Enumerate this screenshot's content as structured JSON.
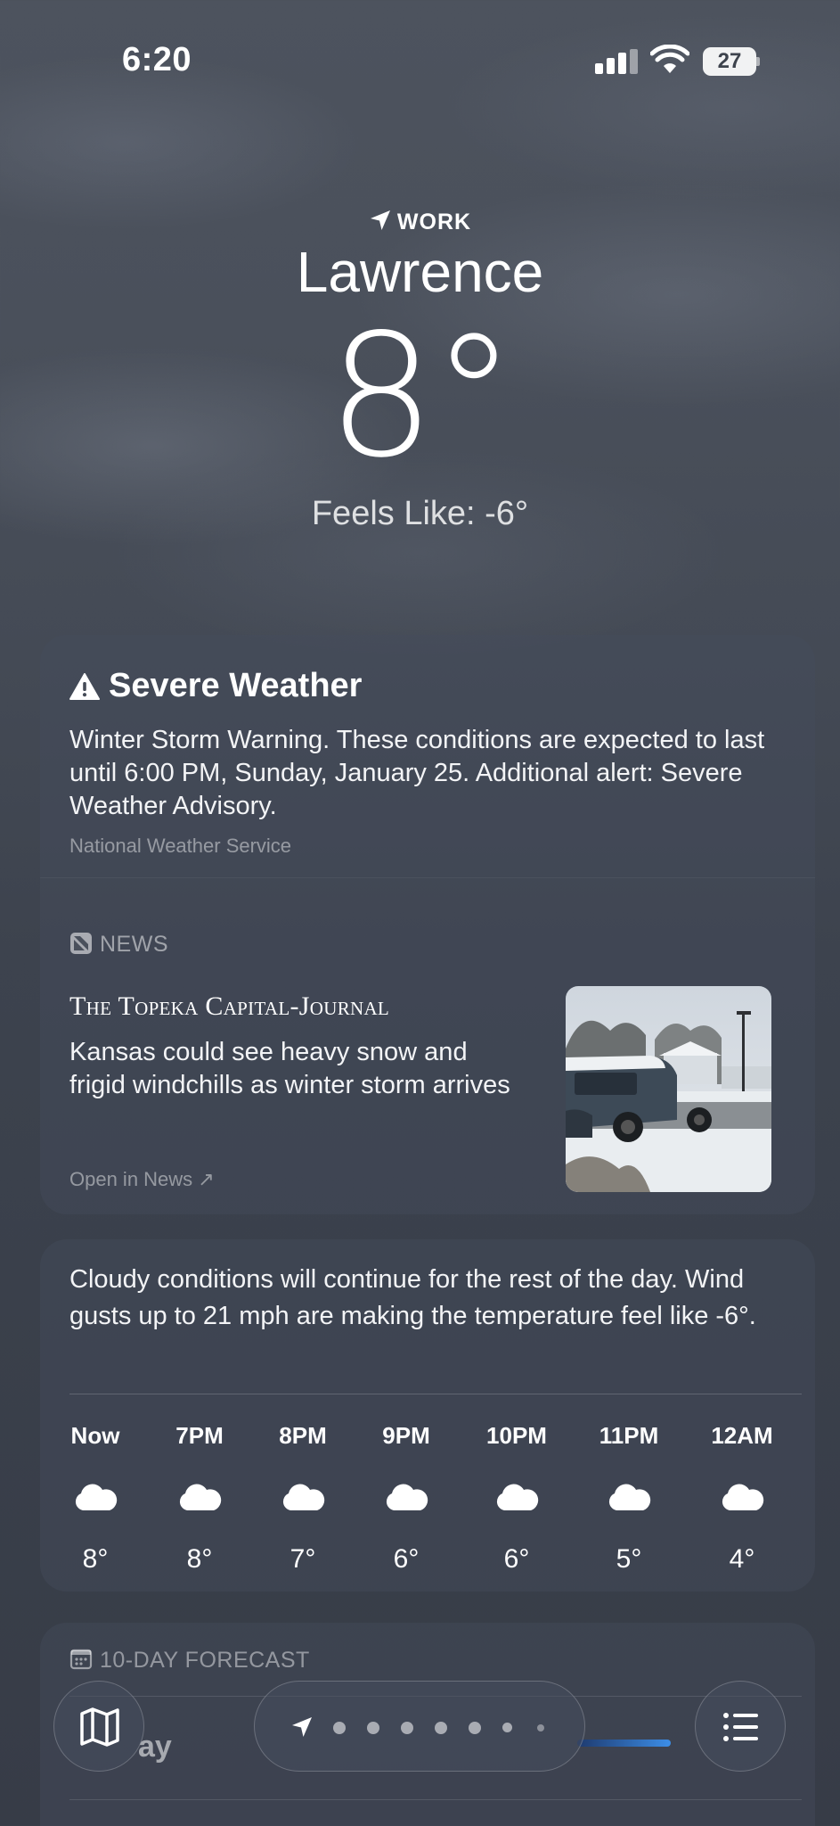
{
  "status_bar": {
    "time": "6:20",
    "battery": "27",
    "icons": [
      "signal-icon",
      "wifi-icon",
      "battery-icon"
    ]
  },
  "header": {
    "location_label": "WORK",
    "city": "Lawrence",
    "temperature": "8°",
    "feels_like": "Feels Like: -6°"
  },
  "alert": {
    "title": "Severe Weather",
    "body": "Winter Storm Warning. These conditions are expected to last until 6:00 PM, Sunday, January 25. Additional alert: Severe Weather Advisory.",
    "source": "National Weather Service",
    "icon": "warning-triangle-icon"
  },
  "news": {
    "label": "NEWS",
    "publisher": "The Topeka Capital-Journal",
    "headline": "Kansas could see heavy snow and frigid windchills as winter storm arrives",
    "open_link": "Open in News ↗"
  },
  "hourly": {
    "summary": "Cloudy conditions will continue for the rest of the day. Wind gusts up to 21 mph are making the temperature feel like -6°.",
    "hours": [
      {
        "label": "Now",
        "temp": "8°",
        "icon": "cloud-icon"
      },
      {
        "label": "7PM",
        "temp": "8°",
        "icon": "cloud-icon"
      },
      {
        "label": "8PM",
        "temp": "7°",
        "icon": "cloud-icon"
      },
      {
        "label": "9PM",
        "temp": "6°",
        "icon": "cloud-icon"
      },
      {
        "label": "10PM",
        "temp": "6°",
        "icon": "cloud-icon"
      },
      {
        "label": "11PM",
        "temp": "5°",
        "icon": "cloud-icon"
      },
      {
        "label": "12AM",
        "temp": "4°",
        "icon": "cloud-icon"
      }
    ]
  },
  "forecast": {
    "label": "10-DAY FORECAST",
    "first_day": "ay"
  },
  "toolbar": {
    "map_icon": "map-icon",
    "list_icon": "list-icon",
    "pager_dot_count": 7
  }
}
